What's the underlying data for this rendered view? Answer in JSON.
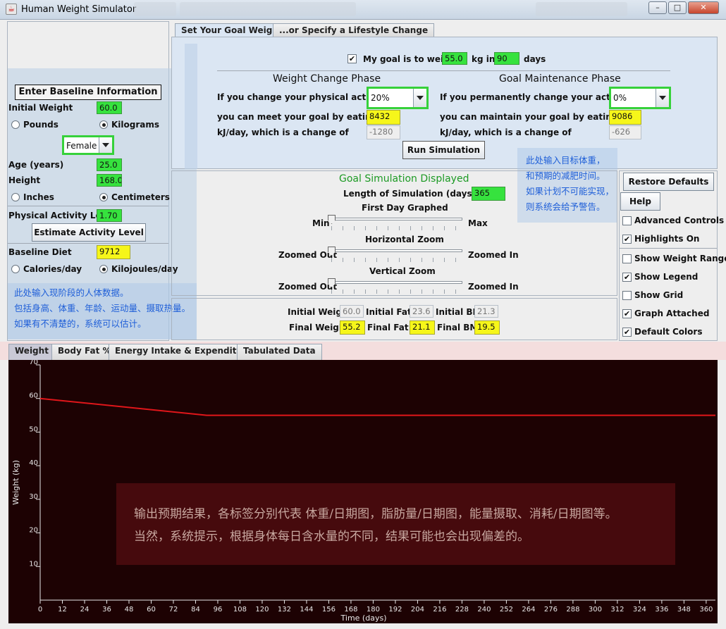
{
  "window": {
    "title": "Human Weight Simulator",
    "app_icon": "java-cup-icon"
  },
  "baseline": {
    "header": "Enter Baseline Information",
    "initial_weight_label": "Initial Weight",
    "initial_weight_value": "60.0",
    "pounds_label": "Pounds",
    "kilograms_label": "Kilograms",
    "weight_unit_selected": "Kilograms",
    "gender_value": "Female",
    "age_label": "Age (years)",
    "age_value": "25.0",
    "height_label": "Height",
    "height_value": "168.0",
    "inches_label": "Inches",
    "centimeters_label": "Centimeters",
    "pal_label": "Physical Activity Level",
    "pal_value": "1.70",
    "estimate_button": "Estimate Activity Level",
    "diet_label": "Baseline Diet",
    "diet_value": "9712",
    "calories_label": "Calories/day",
    "kilojoules_label": "Kilojoules/day",
    "annotation_lines": [
      "此处输入现阶段的人体数据。",
      "包括身高、体重、年龄、运动量、摄取热量。",
      "如果有不清楚的，系统可以估计。"
    ]
  },
  "goal_tabs": [
    "Set Your Goal Weight",
    "...or Specify a Lifestyle Change"
  ],
  "goal": {
    "checkbox_label": "My goal is to weigh",
    "goal_weight": "55.0",
    "kg_in": "kg in",
    "days_value": "90",
    "days_label": "days",
    "change_phase_title": "Weight Change Phase",
    "maintenance_phase_title": "Goal Maintenance Phase",
    "change_activity_label": "If you change your physical activity by",
    "change_activity_value": "20%",
    "perm_activity_label": "If you permanently change your activity by",
    "perm_activity_value": "0%",
    "meet_goal_label": "you can meet your goal by eating",
    "meet_goal_value": "8432",
    "maintain_goal_label": "you can maintain your goal by eating",
    "maintain_goal_value": "9086",
    "change_kj_label": "kJ/day, which is a change of",
    "change_kj_value": "-1280",
    "maintain_kj_label": "kJ/day, which is a change of",
    "maintain_kj_value": "-626",
    "run_button": "Run Simulation",
    "annotation_lines": [
      "此处输入目标体重，",
      "和预期的减肥时间。",
      "如果计划不可能实现，",
      "则系统会给予警告。"
    ]
  },
  "display": {
    "title": "Goal Simulation Displayed",
    "length_label": "Length of Simulation (days)",
    "length_value": "365",
    "first_day_label": "First Day Graphed",
    "min_label": "Min",
    "max_label": "Max",
    "hzoom_label": "Horizontal Zoom",
    "vzoom_label": "Vertical Zoom",
    "zoomed_out": "Zoomed Out",
    "zoomed_in": "Zoomed In"
  },
  "results": {
    "initial_weight_label": "Initial Weight",
    "initial_weight": "60.0",
    "initial_fat_label": "Initial Fat %",
    "initial_fat": "23.6",
    "initial_bmi_label": "Initial BMI",
    "initial_bmi": "21.3",
    "final_weight_label": "Final Weight",
    "final_weight": "55.2",
    "final_fat_label": "Final Fat %",
    "final_fat": "21.1",
    "final_bmi_label": "Final BMI",
    "final_bmi": "19.5"
  },
  "controls": {
    "restore_button": "Restore Defaults",
    "help_button": "Help",
    "checkboxes": [
      {
        "label": "Advanced Controls",
        "checked": false
      },
      {
        "label": "Highlights On",
        "checked": true
      },
      {
        "label": "Show Weight Range",
        "checked": false
      },
      {
        "label": "Show Legend",
        "checked": true
      },
      {
        "label": "Show Grid",
        "checked": false
      },
      {
        "label": "Graph Attached",
        "checked": true
      },
      {
        "label": "Default Colors",
        "checked": true
      }
    ]
  },
  "graph_tabs": [
    "Weight",
    "Body Fat %",
    "Energy Intake & Expenditure",
    "Tabulated Data"
  ],
  "overlay": {
    "line1": "输出预期结果，各标签分别代表 体重/日期图，脂肪量/日期图，能量摄取、消耗/日期图等。",
    "line2": "当然，系统提示，根据身体每日含水量的不同，结果可能也会出现偏差的。"
  },
  "colors": {
    "accent_green": "#36e23e",
    "accent_yellow": "#f6f61a",
    "plot_bg": "#1d0203",
    "series_line": "#e0161a"
  },
  "chart_data": {
    "type": "line",
    "xlabel": "Time (days)",
    "ylabel": "Weight (kg)",
    "xlim": [
      0,
      365
    ],
    "ylim": [
      0,
      70
    ],
    "x_ticks": [
      0,
      12,
      24,
      36,
      48,
      60,
      72,
      84,
      96,
      108,
      120,
      132,
      144,
      156,
      168,
      180,
      192,
      204,
      216,
      228,
      240,
      252,
      264,
      276,
      288,
      300,
      312,
      324,
      336,
      348,
      360
    ],
    "y_ticks": [
      10,
      20,
      30,
      40,
      50,
      60,
      70
    ],
    "series": [
      {
        "x": [
          0,
          90,
          365
        ],
        "y": [
          60.0,
          55.0,
          55.0
        ]
      }
    ],
    "grid": false
  }
}
